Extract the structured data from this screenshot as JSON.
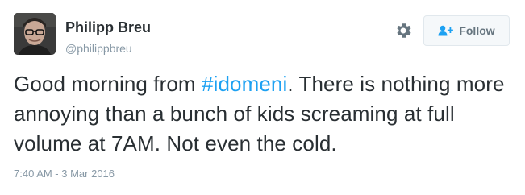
{
  "author": {
    "name": "Philipp Breu",
    "handle": "@philippbreu"
  },
  "actions": {
    "follow_label": "Follow",
    "settings_icon": "gear-icon",
    "follow_icon": "add-user-icon"
  },
  "tweet": {
    "text_before": "Good morning from ",
    "hashtag": "#idomeni",
    "text_after": ". There is nothing more annoying than a bunch of kids screaming at full volume at 7AM. Not even the cold.",
    "timestamp": "7:40 AM - 3 Mar 2016"
  },
  "colors": {
    "link": "#1da1f2",
    "text": "#292f33",
    "muted": "#8899a6"
  }
}
